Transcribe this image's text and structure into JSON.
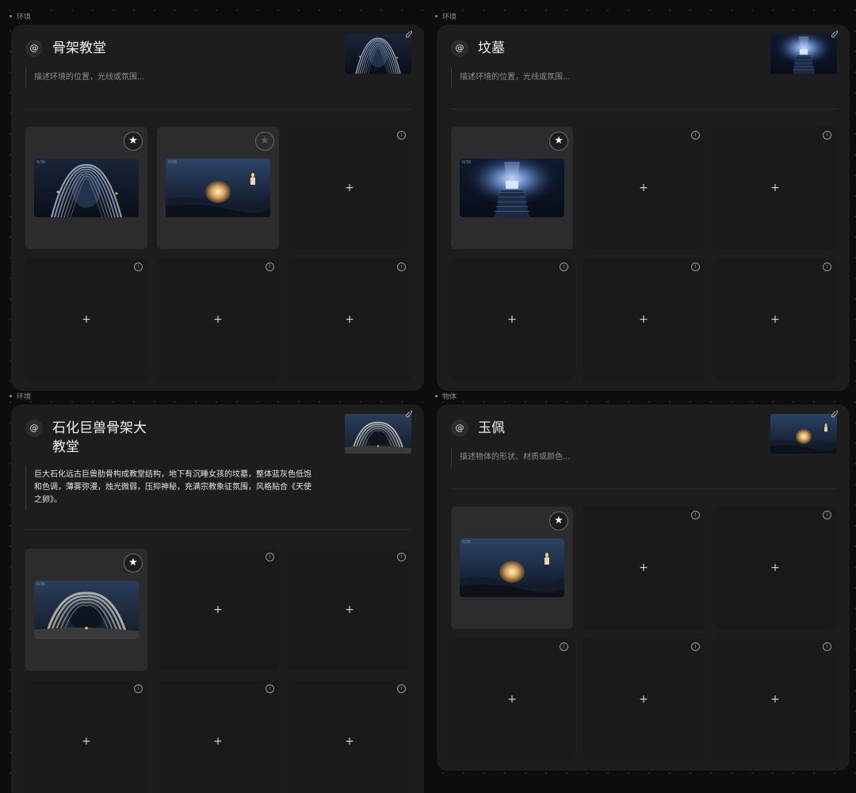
{
  "cards": [
    {
      "tag": "环境",
      "at_symbol": "@",
      "title": "骨架教堂",
      "description": "描述环境的位置，光线或氛围...",
      "description_is_placeholder": true,
      "thumbnail": "ribcage-hall",
      "slots": [
        {
          "state": "filled",
          "image": "ribcage-hall",
          "favorite": true,
          "image_label": "0/36"
        },
        {
          "state": "filled",
          "image": "glowing-egg",
          "favorite": false,
          "image_label": "0/36"
        },
        {
          "state": "empty"
        },
        {
          "state": "empty"
        },
        {
          "state": "empty"
        },
        {
          "state": "empty"
        }
      ]
    },
    {
      "tag": "环境",
      "at_symbol": "@",
      "title": "坟墓",
      "description": "描述环境的位置，光线或氛围...",
      "description_is_placeholder": true,
      "thumbnail": "lit-tomb",
      "slots": [
        {
          "state": "filled",
          "image": "lit-tomb",
          "favorite": true,
          "image_label": "0/36"
        },
        {
          "state": "empty"
        },
        {
          "state": "empty"
        },
        {
          "state": "empty"
        },
        {
          "state": "empty"
        },
        {
          "state": "empty"
        }
      ]
    },
    {
      "tag": "环境",
      "at_symbol": "@",
      "title": "石化巨兽骨架大教堂",
      "description": "巨大石化远古巨兽肋骨构成教堂结构，地下有沉睡女孩的坟墓，整体蓝灰色低饱和色调，薄雾弥漫，烛光微弱，压抑神秘，充满宗教象征氛围，风格贴合《天使之卵》。",
      "description_is_placeholder": false,
      "thumbnail": "stone-ribs",
      "slots": [
        {
          "state": "filled",
          "image": "stone-ribs",
          "favorite": true,
          "image_label": "0/36"
        },
        {
          "state": "empty"
        },
        {
          "state": "empty"
        },
        {
          "state": "empty"
        },
        {
          "state": "empty"
        },
        {
          "state": "empty"
        }
      ]
    },
    {
      "tag": "物体",
      "at_symbol": "@",
      "title": "玉佩",
      "description": "描述物体的形状、材质或颜色...",
      "description_is_placeholder": true,
      "thumbnail": "glowing-egg",
      "slots": [
        {
          "state": "filled",
          "image": "glowing-egg",
          "favorite": true,
          "image_label": "0/36"
        },
        {
          "state": "empty"
        },
        {
          "state": "empty"
        },
        {
          "state": "empty"
        },
        {
          "state": "empty"
        },
        {
          "state": "empty"
        }
      ]
    }
  ],
  "icons": {
    "star": "★",
    "add": "+",
    "info": "i",
    "close": "⁄"
  },
  "colors": {
    "background": "#0d0d0e",
    "card": "#1d1d1e",
    "slot_filled": "#2c2c2e",
    "slot_empty": "#1a1a1b"
  }
}
